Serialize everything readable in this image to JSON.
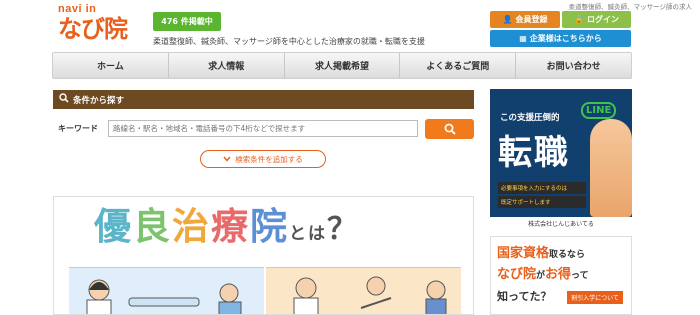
{
  "header": {
    "logo_small": "navi in",
    "logo_big": "なび院",
    "count_badge": "476 件掲載中",
    "tagline": "柔道整復師、鍼灸師、マッサージ師を中心とした治療家の就職・転職を支援",
    "top_note": "柔道整復師、鍼灸師、マッサージ師の求人",
    "register_label": "会員登録",
    "login_label": "ログイン",
    "company_label": "企業様はこちらから"
  },
  "nav": {
    "items": [
      "ホーム",
      "求人情報",
      "求人掲載希望",
      "よくあるご質問",
      "お問い合わせ"
    ]
  },
  "search": {
    "section_title": "条件から探す",
    "keyword_label": "キーワード",
    "placeholder": "路線名・駅名・地域名・電話番号の下4桁などで探せます",
    "add_condition_label": "検索条件を追加する"
  },
  "main_banner": {
    "title_chars": [
      "優",
      "良",
      "治",
      "療",
      "院"
    ],
    "title_tail": "とは",
    "title_q": "？"
  },
  "side_ad1": {
    "subtitle": "この支援圧倒的",
    "line_tag": "LINE",
    "big_text": "転職",
    "box1": "必要事項を入力にするのは",
    "box2": "既定サポートします",
    "footer": "株式会社じんじあいてる"
  },
  "side_ad2": {
    "line1_a": "国家資格",
    "line1_b": "取るなら",
    "line2_a": "なび院",
    "line2_b": "が",
    "line2_c": "お得",
    "line2_d": "って",
    "line3": "知ってた？",
    "badge": "割引入学について"
  },
  "colors": {
    "brand_orange": "#e8601a",
    "green": "#5cb531",
    "blue": "#1e8fd2",
    "brown": "#6e4a22",
    "navy": "#12406e"
  }
}
